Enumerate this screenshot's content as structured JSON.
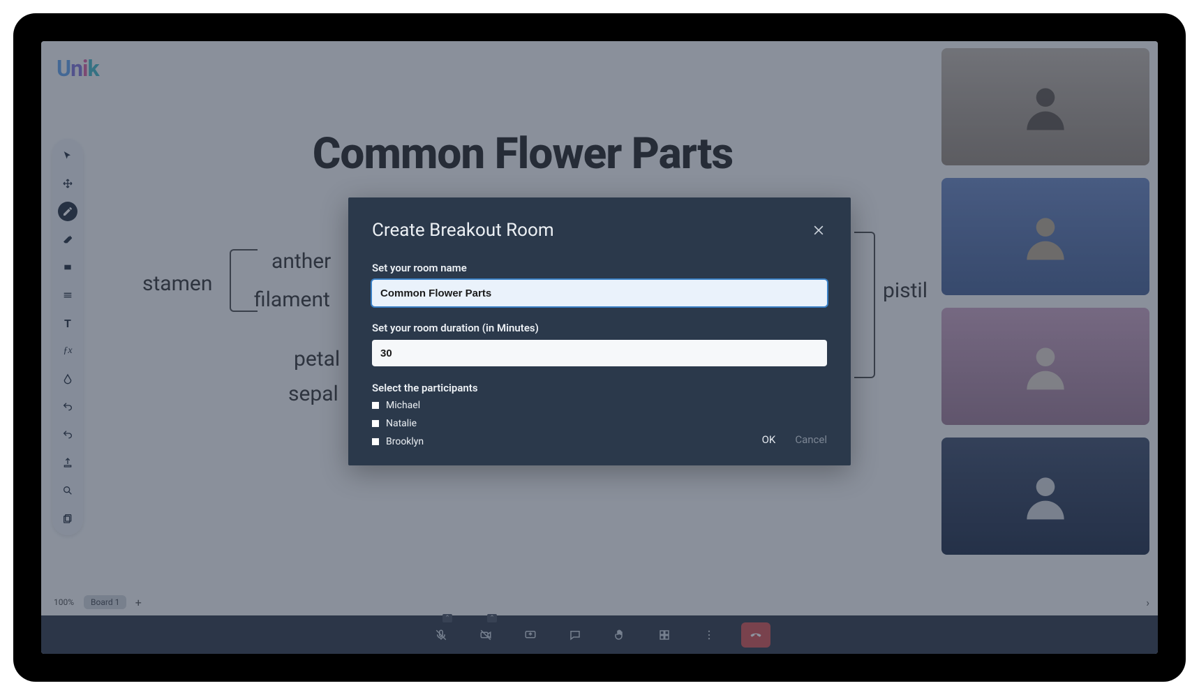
{
  "logo": {
    "u": "U",
    "n": "n",
    "i": "i",
    "k": "k"
  },
  "board": {
    "title": "Common Flower Parts",
    "labels": {
      "stamen": "stamen",
      "anther": "anther",
      "filament": "filament",
      "petal": "petal",
      "sepal": "sepal",
      "pistil": "pistil"
    },
    "zoom": "100%",
    "tab1": "Board 1",
    "add": "+"
  },
  "modal": {
    "title": "Create Breakout Room",
    "name_label": "Set your room name",
    "name_value": "Common Flower Parts",
    "duration_label": "Set your room duration (in Minutes)",
    "duration_value": "30",
    "participants_label": "Select the participants",
    "participants": [
      "Michael",
      "Natalie",
      "Brooklyn"
    ],
    "ok": "OK",
    "cancel": "Cancel"
  },
  "icons": {
    "fx": "ƒx",
    "text_tool": "T"
  }
}
